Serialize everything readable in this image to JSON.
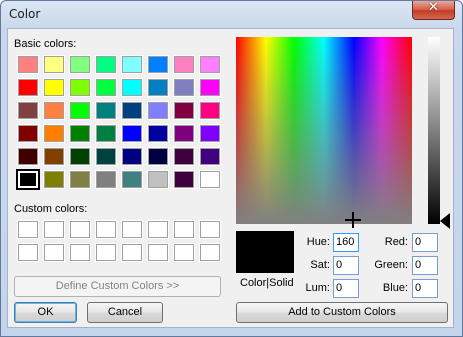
{
  "window": {
    "title": "Color",
    "close_label": "✕"
  },
  "labels": {
    "basic_colors": "Basic colors:",
    "custom_colors": "Custom colors:",
    "color_solid": "Color|Solid"
  },
  "buttons": {
    "define_custom": "Define Custom Colors >>",
    "ok": "OK",
    "cancel": "Cancel",
    "add_custom": "Add to Custom Colors"
  },
  "fields": {
    "hue": {
      "label": "Hue:",
      "value": "160"
    },
    "sat": {
      "label": "Sat:",
      "value": "0"
    },
    "lum": {
      "label": "Lum:",
      "value": "0"
    },
    "red": {
      "label": "Red:",
      "value": "0"
    },
    "green": {
      "label": "Green:",
      "value": "0"
    },
    "blue": {
      "label": "Blue:",
      "value": "0"
    }
  },
  "basic_colors": [
    [
      "#ff8080",
      "#ffff80",
      "#80ff80",
      "#00ff80",
      "#80ffff",
      "#0080ff",
      "#ff80c0",
      "#ff80ff"
    ],
    [
      "#ff0000",
      "#ffff00",
      "#80ff00",
      "#00ff40",
      "#00ffff",
      "#0080c0",
      "#8080c0",
      "#ff00ff"
    ],
    [
      "#804040",
      "#ff8040",
      "#00ff00",
      "#008080",
      "#004080",
      "#8080ff",
      "#800040",
      "#ff0080"
    ],
    [
      "#800000",
      "#ff8000",
      "#008000",
      "#008040",
      "#0000ff",
      "#0000a0",
      "#800080",
      "#8000ff"
    ],
    [
      "#400000",
      "#804000",
      "#004000",
      "#004040",
      "#000080",
      "#000040",
      "#400040",
      "#400080"
    ],
    [
      "#000000",
      "#808000",
      "#808040",
      "#808080",
      "#408080",
      "#c0c0c0",
      "#400040",
      "#ffffff"
    ]
  ],
  "selected_color": "#000000"
}
